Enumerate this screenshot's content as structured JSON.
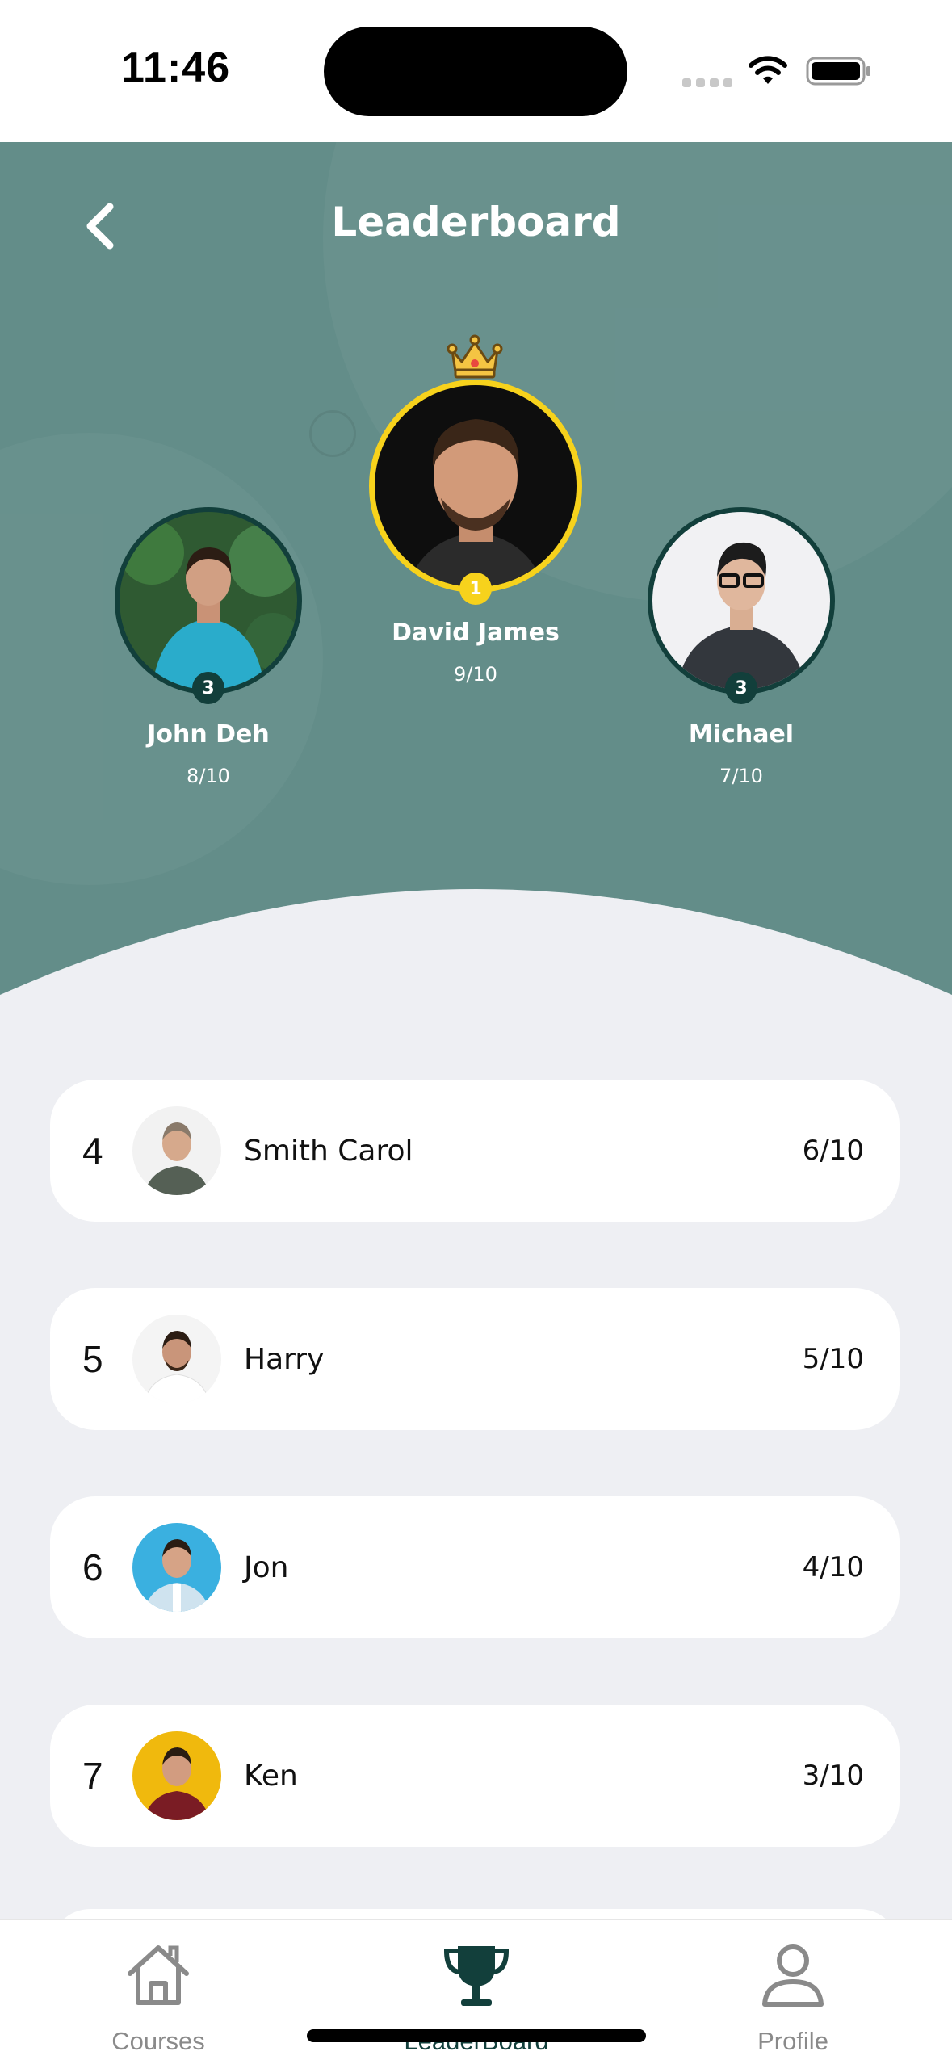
{
  "status_bar": {
    "time": "11:46"
  },
  "header": {
    "title": "Leaderboard"
  },
  "podium": {
    "first": {
      "name": "David James",
      "score": "9/10",
      "rank": "1"
    },
    "second": {
      "name": "John Deh",
      "score": "8/10",
      "rank": "3"
    },
    "third": {
      "name": "Michael",
      "score": "7/10",
      "rank": "3"
    }
  },
  "rankings": [
    {
      "rank": "4",
      "name": "Smith Carol",
      "score": "6/10"
    },
    {
      "rank": "5",
      "name": "Harry",
      "score": "5/10"
    },
    {
      "rank": "6",
      "name": "Jon",
      "score": "4/10"
    },
    {
      "rank": "7",
      "name": "Ken",
      "score": "3/10"
    }
  ],
  "tabs": [
    {
      "label": "Courses",
      "icon": "home-icon"
    },
    {
      "label": "LeaderBoard",
      "icon": "trophy-icon"
    },
    {
      "label": "Profile",
      "icon": "person-icon"
    }
  ],
  "colors": {
    "hero": "#638d89",
    "accent": "#123f3b",
    "gold": "#f7d21c",
    "background": "#eeeff3"
  }
}
